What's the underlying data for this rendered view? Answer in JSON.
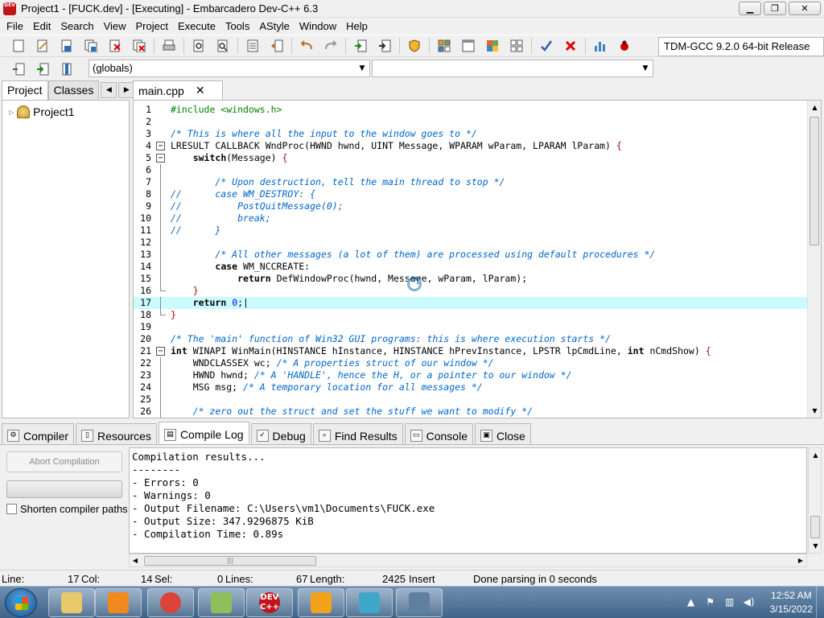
{
  "window": {
    "title": "Project1 - [FUCK.dev] - [Executing] - Embarcadero Dev-C++ 6.3",
    "app_icon_text": "DEV",
    "minimize": "▁",
    "maximize": "❐",
    "close": "✕"
  },
  "menu": [
    "File",
    "Edit",
    "Search",
    "View",
    "Project",
    "Execute",
    "Tools",
    "AStyle",
    "Window",
    "Help"
  ],
  "toolbar": {
    "icons": [
      "new-file",
      "open-file",
      "save-file",
      "save-all",
      "close-file",
      "close-all",
      "print",
      "find",
      "replace",
      "find-next",
      "goto-line",
      "indent",
      "unindent",
      "undo",
      "redo",
      "run",
      "compile-run",
      "debug",
      "class-view",
      "project-view",
      "layout",
      "layout-grid",
      "check",
      "stop",
      "chart",
      "bug"
    ],
    "compiler": "TDM-GCC 9.2.0 64-bit Release"
  },
  "toolbar2": {
    "scope_combo": "(globals)",
    "member_combo": ""
  },
  "left_panel": {
    "tabs": [
      "Project",
      "Classes"
    ],
    "active_tab": "Project",
    "tree": [
      {
        "label": "Project1"
      }
    ]
  },
  "editor": {
    "tab_label": "main.cpp",
    "tab_close": "✕",
    "current_line": 17,
    "lines": [
      {
        "n": "1",
        "fold": "",
        "html": "<span class='c-pp'>#include &lt;windows.h&gt;</span>"
      },
      {
        "n": "2",
        "fold": "",
        "html": ""
      },
      {
        "n": "3",
        "fold": "",
        "html": "<span class='c-comment'>/* This is where all the input to the window goes to */</span>"
      },
      {
        "n": "4",
        "fold": "box",
        "html": "LRESULT CALLBACK WndProc(HWND hwnd, UINT Message, WPARAM wParam, LPARAM lParam) <span class='c-red'>{</span>"
      },
      {
        "n": "5",
        "fold": "box",
        "html": "    <span class='c-kw'>switch</span>(Message) <span class='c-red'>{</span>"
      },
      {
        "n": "6",
        "fold": "line",
        "html": ""
      },
      {
        "n": "7",
        "fold": "line",
        "html": "        <span class='c-comment'>/* Upon destruction, tell the main thread to stop */</span>"
      },
      {
        "n": "8",
        "fold": "line",
        "html": "<span class='c-comment'>//      case WM_DESTROY: {</span>"
      },
      {
        "n": "9",
        "fold": "line",
        "html": "<span class='c-comment'>//          PostQuitMessage(0);</span>"
      },
      {
        "n": "10",
        "fold": "line",
        "html": "<span class='c-comment'>//          break;</span>"
      },
      {
        "n": "11",
        "fold": "line",
        "html": "<span class='c-comment'>//      }</span>"
      },
      {
        "n": "12",
        "fold": "line",
        "html": ""
      },
      {
        "n": "13",
        "fold": "line",
        "html": "        <span class='c-comment'>/* All other messages (a lot of them) are processed using default procedures */</span>"
      },
      {
        "n": "14",
        "fold": "line",
        "html": "        <span class='c-kw'>case</span> WM_NCCREATE:"
      },
      {
        "n": "15",
        "fold": "line",
        "html": "            <span class='c-kw'>return</span> DefWindowProc(hwnd, Message, wParam, lParam);"
      },
      {
        "n": "16",
        "fold": "end",
        "html": "    <span class='c-red'>}</span>"
      },
      {
        "n": "17",
        "fold": "line",
        "html": "    <span class='c-kw'>return</span> <span class='c-num'>0</span>;|"
      },
      {
        "n": "18",
        "fold": "end",
        "html": "<span class='c-red'>}</span>"
      },
      {
        "n": "19",
        "fold": "",
        "html": ""
      },
      {
        "n": "20",
        "fold": "",
        "html": "<span class='c-comment'>/* The 'main' function of Win32 GUI programs: this is where execution starts */</span>"
      },
      {
        "n": "21",
        "fold": "box",
        "html": "<span class='c-kw'>int</span> WINAPI WinMain(HINSTANCE hInstance, HINSTANCE hPrevInstance, LPSTR lpCmdLine, <span class='c-kw'>int</span> nCmdShow) <span class='c-red'>{</span>"
      },
      {
        "n": "22",
        "fold": "line",
        "html": "    WNDCLASSEX wc; <span class='c-comment'>/* A properties struct of our window */</span>"
      },
      {
        "n": "23",
        "fold": "line",
        "html": "    HWND hwnd; <span class='c-comment'>/* A 'HANDLE', hence the H, or a pointer to our window */</span>"
      },
      {
        "n": "24",
        "fold": "line",
        "html": "    MSG msg; <span class='c-comment'>/* A temporary location for all messages */</span>"
      },
      {
        "n": "25",
        "fold": "line",
        "html": ""
      },
      {
        "n": "26",
        "fold": "line",
        "html": "    <span class='c-comment'>/* zero out the struct and set the stuff we want to modify */</span>"
      }
    ]
  },
  "bottom_tabs": [
    {
      "label": "Compiler",
      "icon": "compiler-icon",
      "glyph": "⚙"
    },
    {
      "label": "Resources",
      "icon": "resources-icon",
      "glyph": "▯"
    },
    {
      "label": "Compile Log",
      "icon": "compile-log-icon",
      "glyph": "▤"
    },
    {
      "label": "Debug",
      "icon": "debug-icon",
      "glyph": "✓"
    },
    {
      "label": "Find Results",
      "icon": "find-results-icon",
      "glyph": "⌕"
    },
    {
      "label": "Console",
      "icon": "console-icon",
      "glyph": "▭"
    },
    {
      "label": "Close",
      "icon": "close-panel-icon",
      "glyph": "▣"
    }
  ],
  "active_bottom_tab": "Compile Log",
  "compile_panel": {
    "abort_label": "Abort Compilation",
    "shorten_label": "Shorten compiler paths",
    "log_lines": [
      "Compilation results...",
      "--------",
      "- Errors: 0",
      "- Warnings: 0",
      "- Output Filename: C:\\Users\\vm1\\Documents\\FUCK.exe",
      "- Output Size: 347.9296875 KiB",
      "- Compilation Time: 0.89s"
    ]
  },
  "status": {
    "line_label": "Line:",
    "line": "17",
    "col_label": "Col:",
    "col": "14",
    "sel_label": "Sel:",
    "sel": "0",
    "lines_label": "Lines:",
    "lines": "67",
    "length_label": "Length:",
    "length": "2425",
    "mode": "Insert",
    "message": "Done parsing in 0 seconds"
  },
  "taskbar": {
    "apps": [
      {
        "name": "explorer",
        "color": "#e8c86a"
      },
      {
        "name": "media-player",
        "color": "#f08a1e"
      },
      {
        "name": "chrome",
        "color": "#db4437"
      },
      {
        "name": "notepad",
        "color": "#8fbf5a"
      },
      {
        "name": "devcpp",
        "color": "#c0161b",
        "text": "DEV\nC++"
      },
      {
        "name": "search",
        "color": "#f3a21a"
      },
      {
        "name": "package",
        "color": "#3fa7c9"
      },
      {
        "name": "document",
        "color": "#5f7f9f"
      }
    ],
    "time": "12:52 AM",
    "date": "3/15/2022"
  }
}
